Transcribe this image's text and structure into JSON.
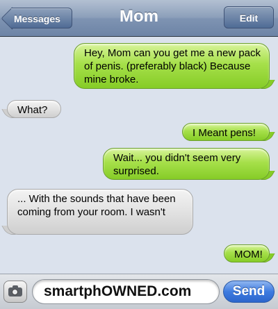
{
  "header": {
    "back_label": "Messages",
    "title": "Mom",
    "edit_label": "Edit"
  },
  "messages": [
    {
      "from": "me",
      "text": "Hey, Mom can you get me a new pack of penis. (preferably black) Because mine broke."
    },
    {
      "from": "mom",
      "text": "What?"
    },
    {
      "from": "me",
      "text": "I Meant pens!"
    },
    {
      "from": "me",
      "text": "Wait... you didn't seem very surprised."
    },
    {
      "from": "mom",
      "text": "... With the sounds that have been coming from your room. I wasn't"
    },
    {
      "from": "me",
      "text": "MOM!"
    }
  ],
  "composer": {
    "camera_icon": "camera-icon",
    "input_value": "smartphOWNED.com",
    "send_label": "Send"
  },
  "colors": {
    "sent_bubble": "#a6e04a",
    "received_bubble": "#e2e2e2",
    "background": "#dbe2ed",
    "send_button": "#3e7be0"
  }
}
